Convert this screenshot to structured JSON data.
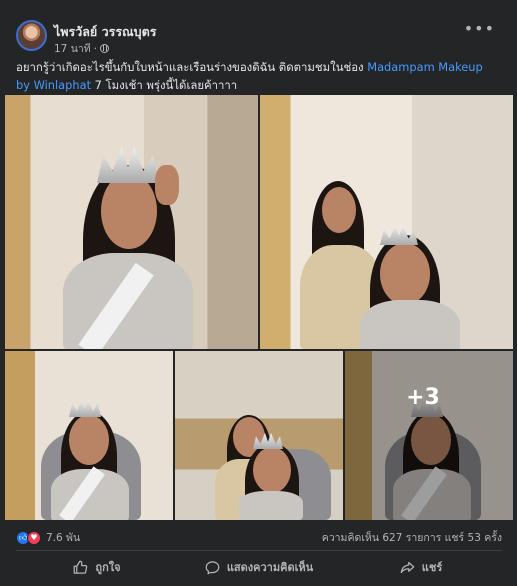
{
  "post": {
    "author": "ไพรวัลย์ วรรณบุตร",
    "time": "17 นาที",
    "separator": "·",
    "more_label": "•••",
    "text_part1": "อยากรู้ว่าเกิดอะไรขึ้นกับใบหน้าและเรือนร่างของดิฉัน ติดตามชมในช่อง ",
    "text_link": "Madampam Makeup by Winlaphat",
    "text_part2": " 7 โมงเช้า พรุ่งนี้ได้เลยค้าาาา"
  },
  "photos": {
    "extra_count": "+3"
  },
  "stats": {
    "like_icon": "thumbs-up-icon",
    "love_icon": "heart-icon",
    "reaction_count": "7.6 พัน",
    "comments_shares": "ความคิดเห็น 627 รายการ  แชร์ 53 ครั้ง"
  },
  "actions": {
    "like": "ถูกใจ",
    "comment": "แสดงความคิดเห็น",
    "share": "แชร์"
  },
  "colors": {
    "background": "#242526",
    "link": "#4599ff",
    "like": "#2078f4",
    "love": "#f33e58"
  }
}
